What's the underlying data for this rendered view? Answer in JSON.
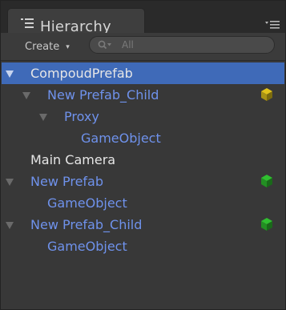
{
  "window": {
    "title": "Hierarchy",
    "tab_icon": "list-icon",
    "menu_icon": "panel-menu-icon"
  },
  "toolbar": {
    "create_label": "Create",
    "create_arrow": "▾",
    "search_placeholder": "All",
    "search_icon": "search-icon"
  },
  "colors": {
    "selection": "#3f6ab8",
    "prefab_text": "#6f92ec",
    "plain_text": "#e6e6e6",
    "prefab_variant_cube": "#e0c21a",
    "prefab_cube": "#2fbf2f"
  },
  "tree": [
    {
      "label": "CompoudPrefab",
      "depth": 0,
      "expanded": true,
      "selected": true,
      "kind": "plain"
    },
    {
      "label": "New Prefab_Child",
      "depth": 1,
      "expanded": true,
      "selected": false,
      "kind": "prefab",
      "badge": "yellow-cube-icon"
    },
    {
      "label": "Proxy",
      "depth": 2,
      "expanded": true,
      "selected": false,
      "kind": "prefab"
    },
    {
      "label": "GameObject",
      "depth": 3,
      "expanded": false,
      "selected": false,
      "kind": "prefab"
    },
    {
      "label": "Main Camera",
      "depth": 0,
      "expanded": false,
      "selected": false,
      "kind": "plain"
    },
    {
      "label": "New Prefab",
      "depth": 0,
      "expanded": true,
      "selected": false,
      "kind": "prefab",
      "badge": "green-cube-icon"
    },
    {
      "label": "GameObject",
      "depth": 1,
      "expanded": false,
      "selected": false,
      "kind": "prefab"
    },
    {
      "label": "New Prefab_Child",
      "depth": 0,
      "expanded": true,
      "selected": false,
      "kind": "prefab",
      "badge": "green-cube-icon"
    },
    {
      "label": "GameObject",
      "depth": 1,
      "expanded": false,
      "selected": false,
      "kind": "prefab"
    }
  ]
}
